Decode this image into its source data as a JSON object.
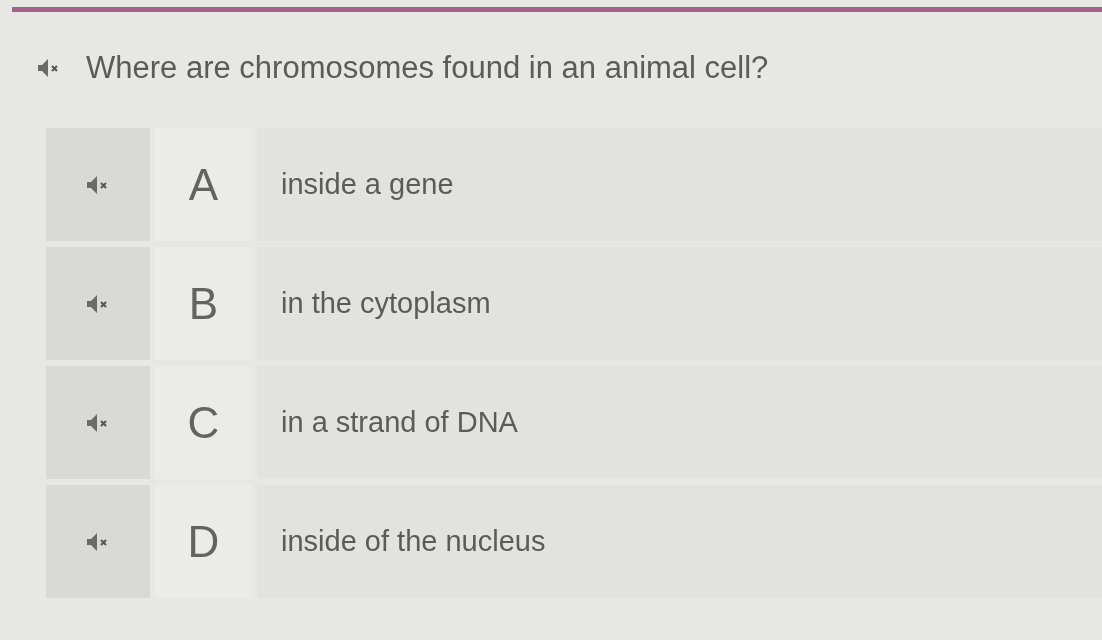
{
  "question": {
    "text": "Where are chromosomes found in an animal cell?"
  },
  "options": [
    {
      "letter": "A",
      "text": "inside a gene"
    },
    {
      "letter": "B",
      "text": "in the cytoplasm"
    },
    {
      "letter": "C",
      "text": "in a strand of DNA"
    },
    {
      "letter": "D",
      "text": "inside of the nucleus"
    }
  ]
}
